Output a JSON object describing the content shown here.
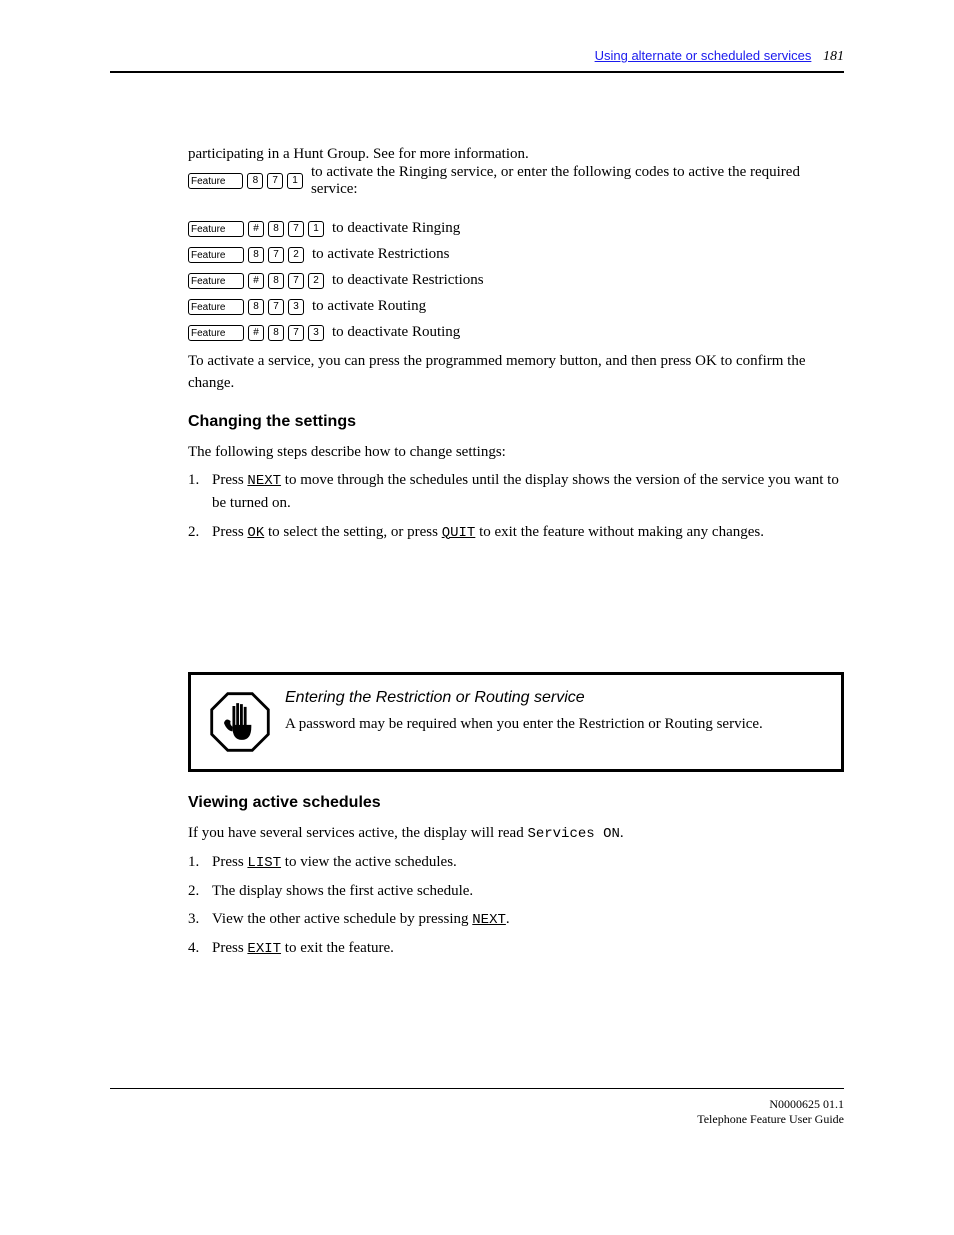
{
  "header": {
    "section_link": "Using alternate or scheduled services",
    "page_number": "181"
  },
  "intro_line": "participating in a Hunt Group. See ",
  "intro_line_end": " for more information.",
  "section1": {
    "instructions": [
      "To activate a service, you can press the programmed memory button, and then press OK to confirm the change."
    ],
    "key_rows": [
      {
        "label": "Feature",
        "keys": [
          "8",
          "7",
          "1"
        ],
        "trailing": "to activate the Ringing service, or enter the following codes to active the required service:"
      },
      {
        "label": "Feature",
        "keys": [
          "#",
          "8",
          "7",
          "1"
        ],
        "trailing": "to deactivate Ringing"
      },
      {
        "label": "Feature",
        "keys": [
          "8",
          "7",
          "2"
        ],
        "trailing": "to activate Restrictions"
      },
      {
        "label": "Feature",
        "keys": [
          "#",
          "8",
          "7",
          "2"
        ],
        "trailing": "to deactivate Restrictions"
      },
      {
        "label": "Feature",
        "keys": [
          "8",
          "7",
          "3"
        ],
        "trailing": "to activate Routing"
      },
      {
        "label": "Feature",
        "keys": [
          "#",
          "8",
          "7",
          "3"
        ],
        "trailing": "to deactivate Routing"
      }
    ]
  },
  "section2": {
    "title": "Changing the settings",
    "lines": [
      "The following steps describe how to change settings:",
      {
        "num": "1.",
        "pre": "Press ",
        "key": "NEXT",
        "post": " to move through the schedules until the display shows the version of the service you want to be turned on."
      },
      {
        "num": "2.",
        "pre": "Press ",
        "key1": "OK",
        "mid": " to select the setting, or press ",
        "key2": "QUIT",
        "post": " to exit the feature without making any changes."
      }
    ]
  },
  "note": {
    "title": "Entering the Restriction or Routing service",
    "body": "A password may be required when you enter the Restriction or Routing service."
  },
  "section3": {
    "title": "Viewing active schedules",
    "lines": [
      {
        "text_pre": "If you have several services active, the display will read ",
        "mono": "Services ON",
        "text_post": "."
      },
      {
        "num": "1.",
        "pre": "Press ",
        "key": "LIST",
        "post": " to view the active schedules."
      },
      {
        "num": "2.",
        "pre": "The display shows the first active schedule."
      },
      {
        "num": "3.",
        "pre": "View the other active schedule by pressing ",
        "key": "NEXT",
        "post": "."
      },
      {
        "num": "4.",
        "pre": "Press ",
        "key": "EXIT",
        "post": " to exit the feature."
      }
    ]
  },
  "footer": {
    "line1": "N0000625 01.1",
    "line2": "Telephone Feature User Guide"
  }
}
